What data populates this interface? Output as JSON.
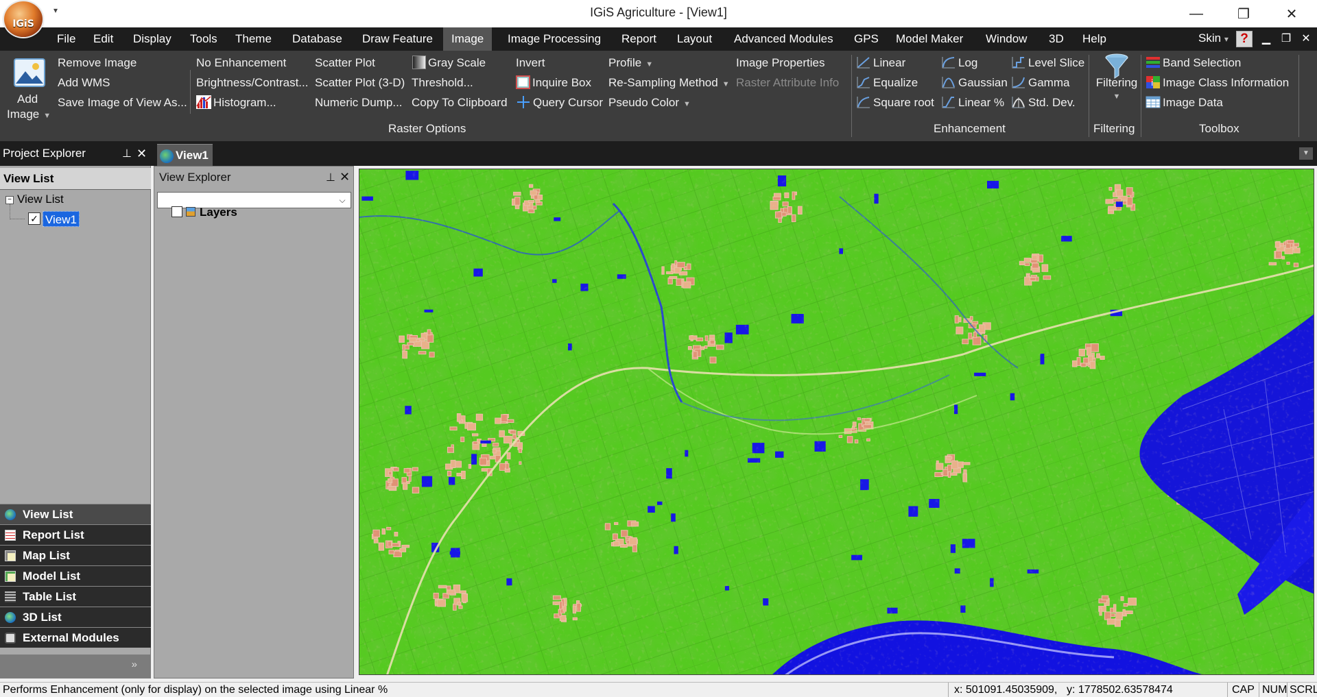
{
  "window": {
    "title": "IGiS Agriculture - [View1]",
    "logo_text": "IGiS",
    "qat_arrow": "▾",
    "minimize": "—",
    "restore": "❐",
    "close": "✕"
  },
  "menu": {
    "items": [
      "File",
      "Edit",
      "Display",
      "Tools",
      "Theme",
      "Database",
      "Draw Feature",
      "Image",
      "Image Processing",
      "Report",
      "Layout",
      "Advanced Modules",
      "GPS",
      "Model Maker",
      "Window",
      "3D",
      "Help"
    ],
    "active": "Image",
    "skin_label": "Skin",
    "skin_arrow": "▾",
    "help_icon": "?",
    "mdi_min": "▁",
    "mdi_restore": "❐",
    "mdi_close": "✕"
  },
  "ribbon": {
    "add_image": {
      "line1": "Add",
      "line2": "Image"
    },
    "image_group": [
      "Remove Image",
      "Add WMS",
      "Save Image of View As..."
    ],
    "col_enh": [
      "No Enhancement",
      "Brightness/Contrast...",
      "Histogram..."
    ],
    "col_scatter": [
      "Scatter Plot",
      "Scatter Plot (3-D)",
      "Numeric Dump..."
    ],
    "col_gray": [
      "Gray Scale",
      "Threshold...",
      "Copy To Clipboard"
    ],
    "col_invert": [
      "Invert",
      "Inquire Box",
      "Query Cursor"
    ],
    "col_profile": [
      "Profile",
      "Re-Sampling Method",
      "Pseudo Color"
    ],
    "col_props": [
      "Image Properties",
      "Raster Attribute Info"
    ],
    "raster_options_label": "Raster Options",
    "enhancement": {
      "col1": [
        "Linear",
        "Equalize",
        "Square root"
      ],
      "col2": [
        "Log",
        "Gaussian",
        "Linear %"
      ],
      "col3": [
        "Level Slice",
        "Gamma",
        "Std. Dev."
      ],
      "label": "Enhancement"
    },
    "filtering": {
      "button": "Filtering",
      "label": "Filtering"
    },
    "toolbox": {
      "items": [
        "Band Selection",
        "Image Class Information",
        "Image Data"
      ],
      "label": "Toolbox"
    }
  },
  "tabs": {
    "project_explorer_title": "Project Explorer",
    "document_tab": "View1",
    "pin_icon": "📌",
    "close_icon": "✕"
  },
  "project_explorer": {
    "header": "View List",
    "tree_root": "View List",
    "tree_child": "View1",
    "expander": "−",
    "checkmark": "✓",
    "nav": [
      "View List",
      "Report List",
      "Map List",
      "Model List",
      "Table List",
      "3D List",
      "External Modules"
    ],
    "footer_chevron": "»"
  },
  "view_explorer": {
    "title": "View Explorer",
    "layers_label": "Layers",
    "combo_arrow": "⌵"
  },
  "status": {
    "message": "Performs Enhancement (only for display) on the selected image using Linear %",
    "x_coord": "x: 501091.45035909,",
    "y_coord": "y: 1778502.63578474",
    "cap": "CAP",
    "num": "NUM",
    "scrl": "SCRL"
  },
  "colors": {
    "ribbon_bg": "#3d3d3d",
    "menu_bg": "#1d1d1d",
    "map_vegetation": "#5ed623",
    "map_water": "#1a1ae0",
    "map_urban": "#e08a6a"
  }
}
